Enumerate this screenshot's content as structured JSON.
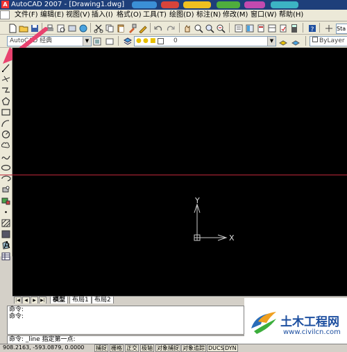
{
  "window": {
    "title": "AutoCAD 2007 - [Drawing1.dwg]",
    "app_icon_letter": "A"
  },
  "menu": [
    "文件(F)",
    "编辑(E)",
    "视图(V)",
    "插入(I)",
    "格式(O)",
    "工具(T)",
    "绘图(D)",
    "标注(N)",
    "修改(M)",
    "窗口(W)",
    "帮助(H)"
  ],
  "workspace": {
    "value": "AutoCAD 经典"
  },
  "layer": {
    "value": "0"
  },
  "color_combo": {
    "value": "ByLayer"
  },
  "toolbar_overflow_label": "Sta",
  "ucs": {
    "x_label": "X",
    "y_label": "Y"
  },
  "layout_tabs": [
    "模型",
    "布局1",
    "布局2"
  ],
  "command": {
    "history": [
      "命令:",
      "命令:"
    ],
    "current": "命令: _line 指定第一点:"
  },
  "status": {
    "coords": "908.2163, -593.0879, 0.0000",
    "buttons": [
      "捕捉",
      "栅格",
      "正交",
      "极轴",
      "对象捕捉",
      "对象追踪",
      "DUCS",
      "DYN"
    ]
  },
  "watermark": {
    "brand": "土木工程网",
    "url": "www.civilcn.com"
  },
  "colors": {
    "canvas": "#000000",
    "crosshair_line": "#c0283a",
    "annotation_arrow": "#e8436f"
  }
}
